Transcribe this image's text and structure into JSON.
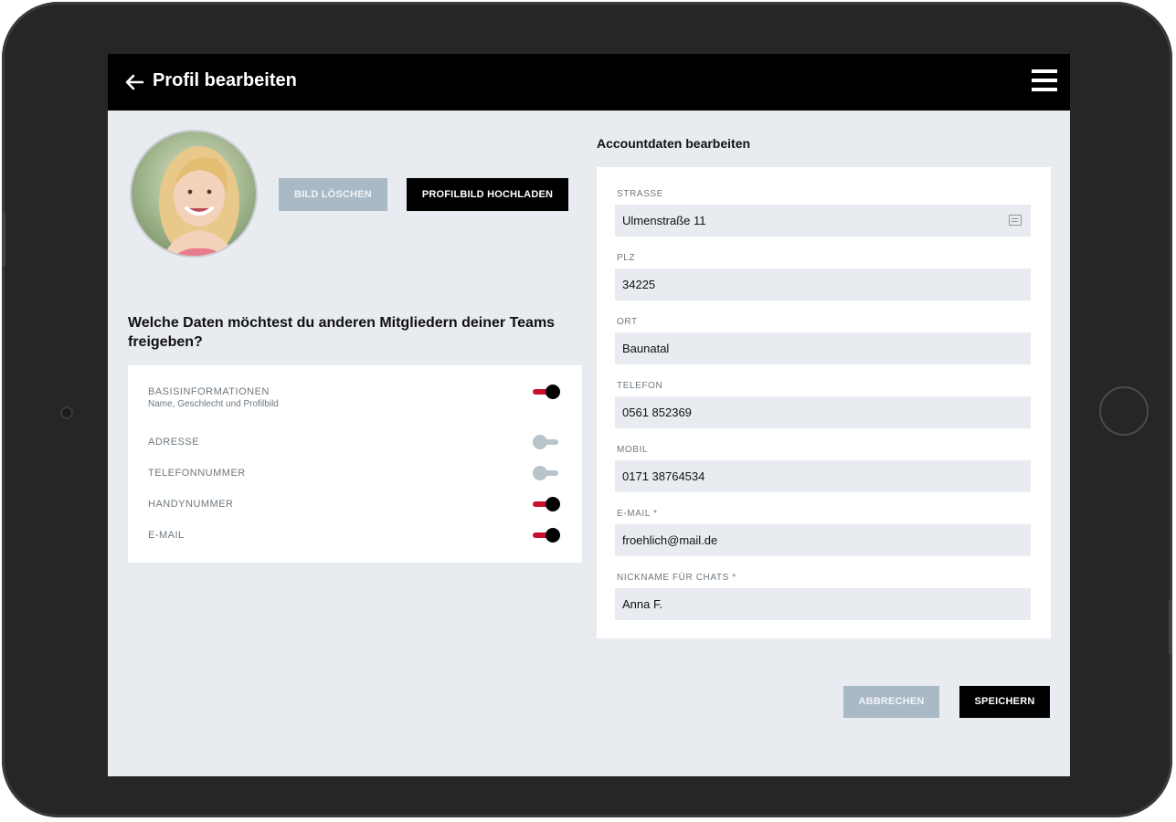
{
  "header": {
    "title": "Profil bearbeiten"
  },
  "profile": {
    "delete_label": "BILD LÖSCHEN",
    "upload_label": "PROFILBILD HOCHLADEN"
  },
  "sharing": {
    "question": "Welche Daten möchtest du anderen Mitgliedern deiner Teams freigeben?",
    "items": [
      {
        "label": "BASISINFORMATIONEN",
        "sublabel": "Name, Geschlecht und Profilbild",
        "enabled": true
      },
      {
        "label": "ADRESSE",
        "enabled": false
      },
      {
        "label": "TELEFONNUMMER",
        "enabled": false
      },
      {
        "label": "HANDYNUMMER",
        "enabled": true
      },
      {
        "label": "E-MAIL",
        "enabled": true
      }
    ]
  },
  "account": {
    "heading": "Accountdaten bearbeiten",
    "fields": [
      {
        "label": "STRASSE",
        "value": "Ulmenstraße 11"
      },
      {
        "label": "PLZ",
        "value": "34225"
      },
      {
        "label": "ORT",
        "value": "Baunatal"
      },
      {
        "label": "TELEFON",
        "value": "0561 852369"
      },
      {
        "label": "MOBIL",
        "value": "0171 38764534"
      },
      {
        "label": "E-MAIL *",
        "value": "froehlich@mail.de"
      },
      {
        "label": "NICKNAME FÜR CHATS *",
        "value": "Anna F."
      }
    ]
  },
  "footer": {
    "cancel_label": "ABBRECHEN",
    "save_label": "SPEICHERN"
  },
  "colors": {
    "accent": "#c8102e",
    "toggle_off": "#b9c3ca",
    "button_gray": "#a9b9c5",
    "background": "#e8ebef"
  }
}
